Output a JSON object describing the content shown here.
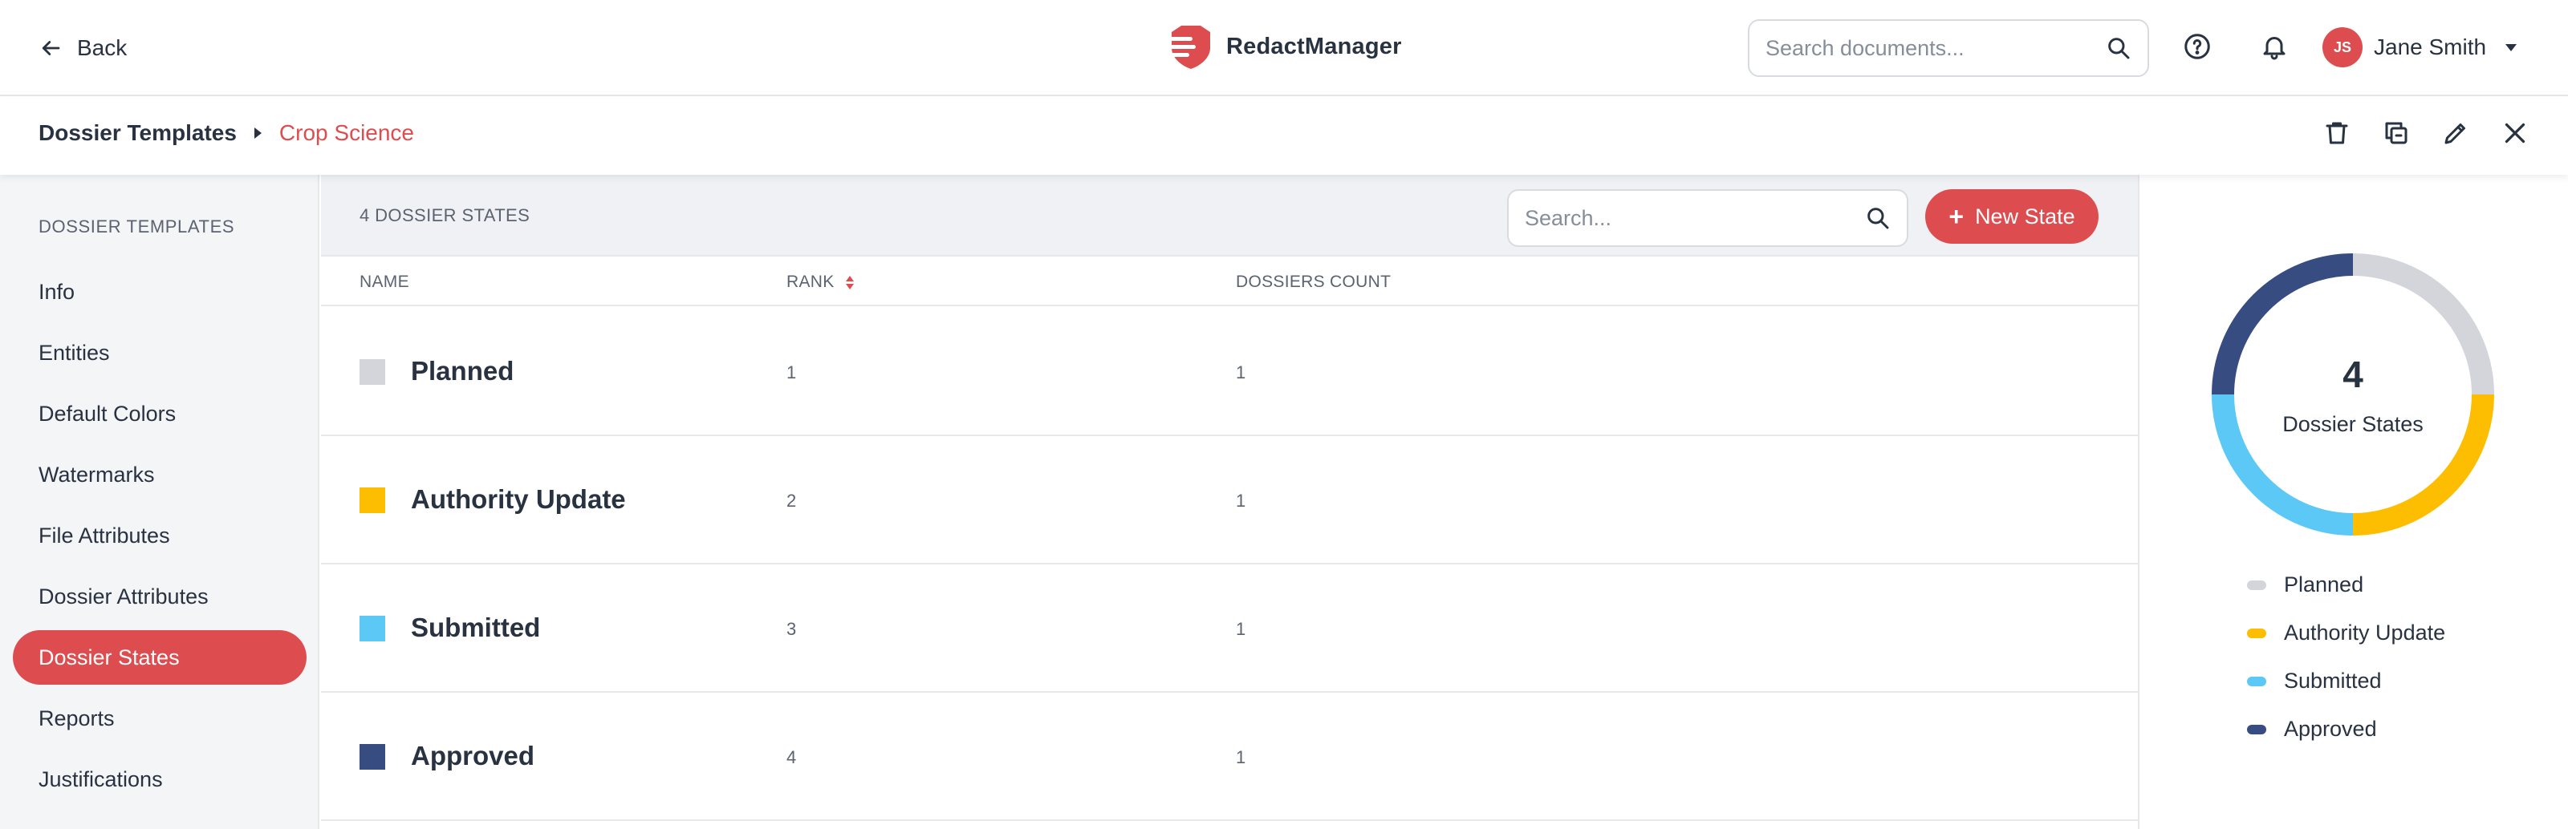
{
  "topbar": {
    "back_label": "Back",
    "logo_text": "RedactManager",
    "search_placeholder": "Search documents...",
    "user_initials": "JS",
    "user_name": "Jane Smith"
  },
  "breadcrumb": {
    "root": "Dossier Templates",
    "current": "Crop Science"
  },
  "sidebar": {
    "heading": "DOSSIER TEMPLATES",
    "items": [
      {
        "label": "Info"
      },
      {
        "label": "Entities"
      },
      {
        "label": "Default Colors"
      },
      {
        "label": "Watermarks"
      },
      {
        "label": "File Attributes"
      },
      {
        "label": "Dossier Attributes"
      },
      {
        "label": "Dossier States",
        "active": true
      },
      {
        "label": "Reports"
      },
      {
        "label": "Justifications"
      }
    ]
  },
  "main": {
    "count_label": "4 DOSSIER STATES",
    "search_placeholder": "Search...",
    "new_button_label": "New State",
    "columns": {
      "name": "NAME",
      "rank": "RANK",
      "count": "DOSSIERS COUNT"
    },
    "rows": [
      {
        "name": "Planned",
        "rank": "1",
        "count": "1",
        "color": "#d3d5da"
      },
      {
        "name": "Authority Update",
        "rank": "2",
        "count": "1",
        "color": "#fdbd00"
      },
      {
        "name": "Submitted",
        "rank": "3",
        "count": "1",
        "color": "#5bc8f5"
      },
      {
        "name": "Approved",
        "rank": "4",
        "count": "1",
        "color": "#374c81"
      }
    ]
  },
  "summary": {
    "total": "4",
    "label": "Dossier States",
    "legend": [
      {
        "label": "Planned",
        "color": "#d3d5da"
      },
      {
        "label": "Authority Update",
        "color": "#fdbd00"
      },
      {
        "label": "Submitted",
        "color": "#5bc8f5"
      },
      {
        "label": "Approved",
        "color": "#374c81"
      }
    ]
  },
  "colors": {
    "accent": "#dd4d50",
    "text": "#283241",
    "muted": "#5b6370"
  }
}
